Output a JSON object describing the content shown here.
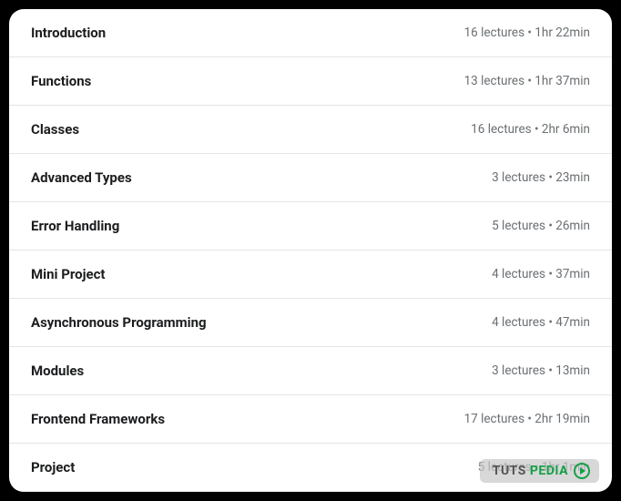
{
  "sections": [
    {
      "title": "Introduction",
      "meta": "16 lectures • 1hr 22min"
    },
    {
      "title": "Functions",
      "meta": "13 lectures • 1hr 37min"
    },
    {
      "title": "Classes",
      "meta": "16 lectures • 2hr 6min"
    },
    {
      "title": "Advanced Types",
      "meta": "3 lectures • 23min"
    },
    {
      "title": "Error Handling",
      "meta": "5 lectures • 26min"
    },
    {
      "title": "Mini Project",
      "meta": "4 lectures • 37min"
    },
    {
      "title": "Asynchronous Programming",
      "meta": "4 lectures • 47min"
    },
    {
      "title": "Modules",
      "meta": "3 lectures • 13min"
    },
    {
      "title": "Frontend Frameworks",
      "meta": "17 lectures • 2hr 19min"
    },
    {
      "title": "Project",
      "meta": "5 lectures • 1hr 1min"
    }
  ],
  "watermark": {
    "part1": "TUTS",
    "part2": "PEDIA"
  }
}
